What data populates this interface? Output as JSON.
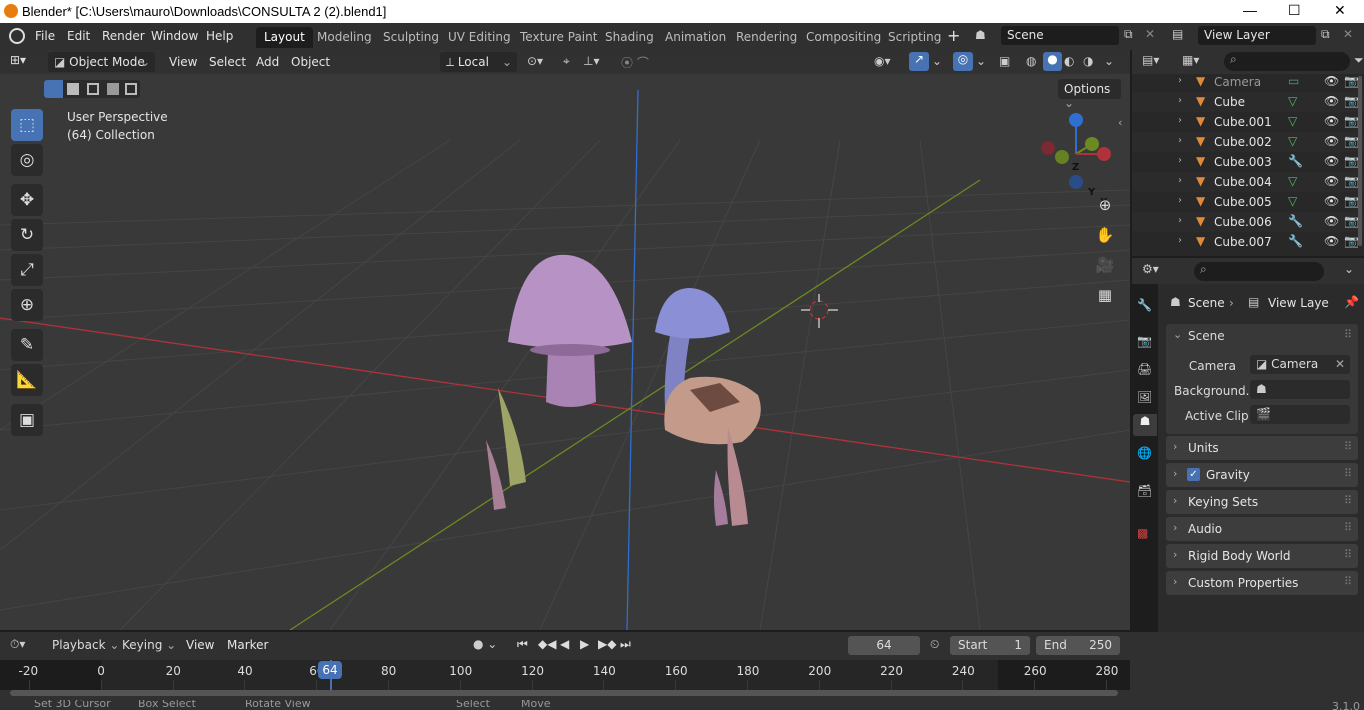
{
  "window": {
    "title": "Blender* [C:\\Users\\mauro\\Downloads\\CONSULTA 2 (2).blend1]",
    "min": "—",
    "max": "☐",
    "close": "✕"
  },
  "menus": [
    "File",
    "Edit",
    "Render",
    "Window",
    "Help"
  ],
  "workspaces": [
    "Layout",
    "Modeling",
    "Sculpting",
    "UV Editing",
    "Texture Paint",
    "Shading",
    "Animation",
    "Rendering",
    "Compositing",
    "Scripting"
  ],
  "scene": {
    "name": "Scene",
    "view_layer": "View Layer"
  },
  "viewport": {
    "mode": "Object Mode",
    "menus": [
      "View",
      "Select",
      "Add",
      "Object"
    ],
    "orientation": "Local",
    "options": "Options",
    "info_line1": "User Perspective",
    "info_line2": "(64) Collection",
    "gizmo": {
      "z": "Z",
      "y": "Y",
      "x": "X"
    }
  },
  "outliner": {
    "items": [
      {
        "name": "Camera",
        "icon": "camera-data-icon"
      },
      {
        "name": "Cube",
        "icon": "mesh-data-icon"
      },
      {
        "name": "Cube.001",
        "icon": "mesh-data-icon"
      },
      {
        "name": "Cube.002",
        "icon": "mesh-data-icon"
      },
      {
        "name": "Cube.003",
        "icon": "modifier-icon"
      },
      {
        "name": "Cube.004",
        "icon": "mesh-data-icon"
      },
      {
        "name": "Cube.005",
        "icon": "mesh-data-icon"
      },
      {
        "name": "Cube.006",
        "icon": "modifier-icon"
      },
      {
        "name": "Cube.007",
        "icon": "modifier-icon"
      }
    ]
  },
  "properties": {
    "breadcrumb_scene": "Scene",
    "breadcrumb_view": "View Laye",
    "section_scene": "Scene",
    "camera_label": "Camera",
    "camera_value": "Camera",
    "background_label": "Background...",
    "active_clip_label": "Active Clip",
    "panels": [
      "Units",
      "Gravity",
      "Keying Sets",
      "Audio",
      "Rigid Body World",
      "Custom Properties"
    ],
    "gravity_checked": true
  },
  "timeline": {
    "menus": [
      "Playback",
      "Keying",
      "View",
      "Marker"
    ],
    "current_frame": "64",
    "start_label": "Start",
    "start_value": "1",
    "end_label": "End",
    "end_value": "250",
    "ticks": [
      "-20",
      "0",
      "20",
      "40",
      "60",
      "80",
      "100",
      "120",
      "140",
      "160",
      "180",
      "200",
      "220",
      "240",
      "260",
      "280"
    ],
    "playhead": "64"
  },
  "statusbar": {
    "items": [
      "Set 3D Cursor",
      "Box Select",
      "Rotate View",
      "Select",
      "Move"
    ],
    "version": "3.1.0"
  },
  "colors": {
    "accent": "#4772b3",
    "bg": "#393939",
    "header": "#303030",
    "x_axis": "#b0323a",
    "y_axis": "#6b8a22",
    "z_axis": "#2f6fd0"
  }
}
